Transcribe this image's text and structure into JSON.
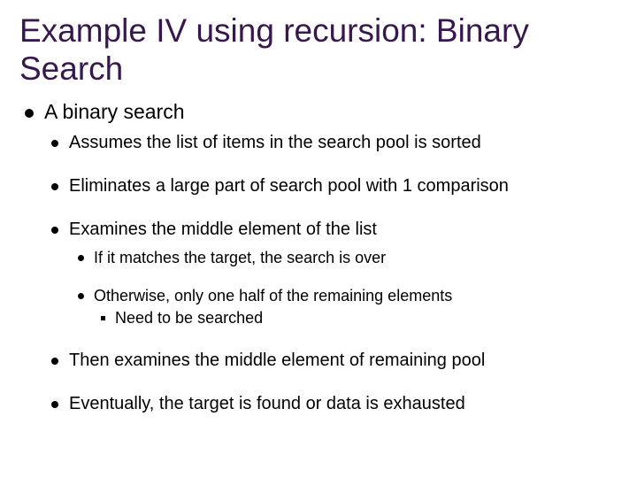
{
  "title": "Example IV using recursion: Binary Search",
  "l1": {
    "t": "A binary search",
    "c": [
      {
        "t": "Assumes the list of items in the search pool is sorted"
      },
      {
        "t": "Eliminates a large part of search pool with 1 comparison"
      },
      {
        "t": "Examines the middle element of the list",
        "c": [
          {
            "t": "If it matches the target, the search is over"
          },
          {
            "t": "Otherwise, only one half of the remaining elements",
            "c": [
              {
                "t": "Need to be searched"
              }
            ]
          }
        ]
      },
      {
        "t": "Then examines the middle element of remaining pool"
      },
      {
        "t": "Eventually, the target is found or data is exhausted"
      }
    ]
  }
}
